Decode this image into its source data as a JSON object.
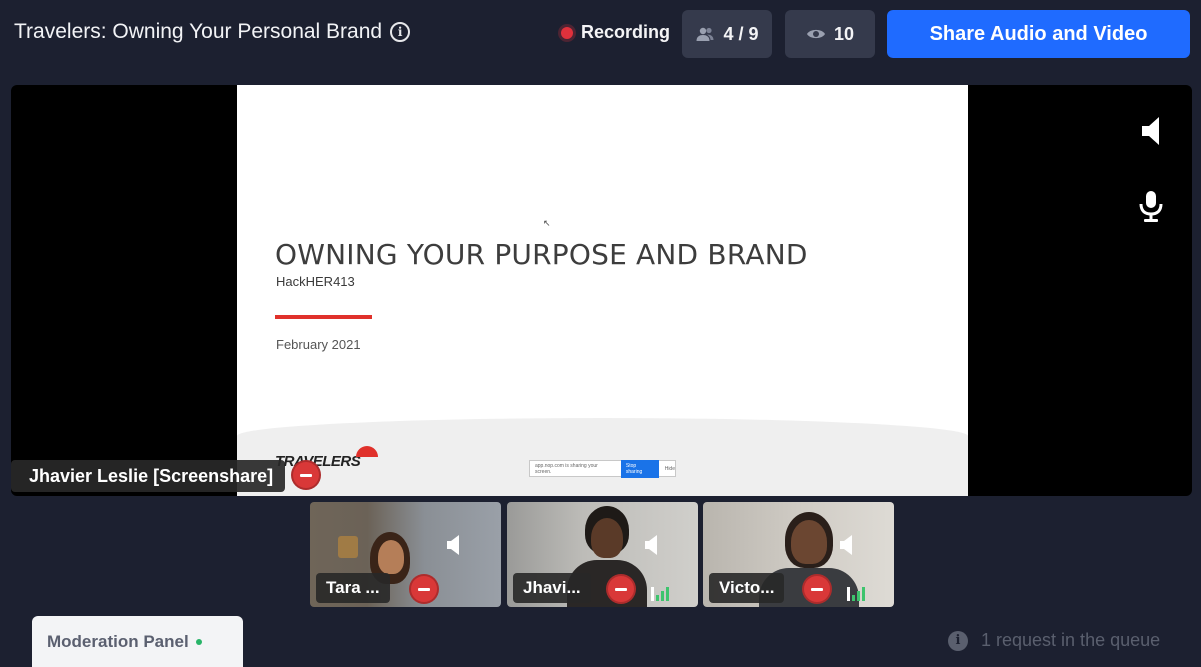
{
  "header": {
    "title": "Travelers: Owning Your Personal Brand",
    "recording_label": "Recording",
    "participants_count": "4 / 9",
    "viewers_count": "10",
    "share_button_label": "Share Audio and Video"
  },
  "stage": {
    "presenter_label": "Jhavier Leslie [Screenshare]",
    "slide": {
      "title": "OWNING YOUR PURPOSE AND BRAND",
      "subtitle": "HackHER413",
      "date": "February 2021",
      "brand": "TRAVELERS",
      "share_notice_text": "app.nop.com is sharing your screen.",
      "stop_sharing_label": "Stop sharing",
      "hide_label": "Hide"
    }
  },
  "participants": [
    {
      "name": "Tara ..."
    },
    {
      "name": "Jhavi..."
    },
    {
      "name": "Victo..."
    }
  ],
  "footer": {
    "moderation_panel_label": "Moderation Panel",
    "queue_text": "1 request in the queue"
  },
  "colors": {
    "background": "#1c2030",
    "accent": "#1f6bff",
    "recording": "#e0313c",
    "remove": "#d93838"
  },
  "icons": [
    "info-icon",
    "recording-dot-icon",
    "users-icon",
    "eye-icon",
    "speaker-icon",
    "microphone-icon",
    "remove-icon",
    "signal-icon",
    "info-circle-icon"
  ]
}
